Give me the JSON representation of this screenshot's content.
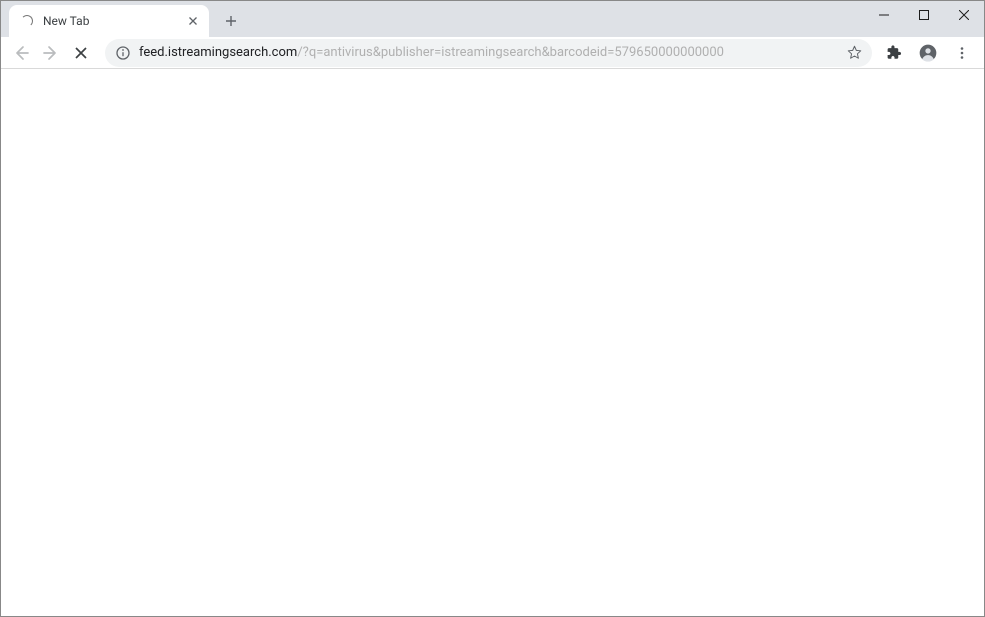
{
  "tab": {
    "title": "New Tab"
  },
  "url": {
    "domain": "feed.istreamingsearch.com",
    "path": "/?q=antivirus&publisher=istreamingsearch&barcodeid=579650000000000"
  }
}
